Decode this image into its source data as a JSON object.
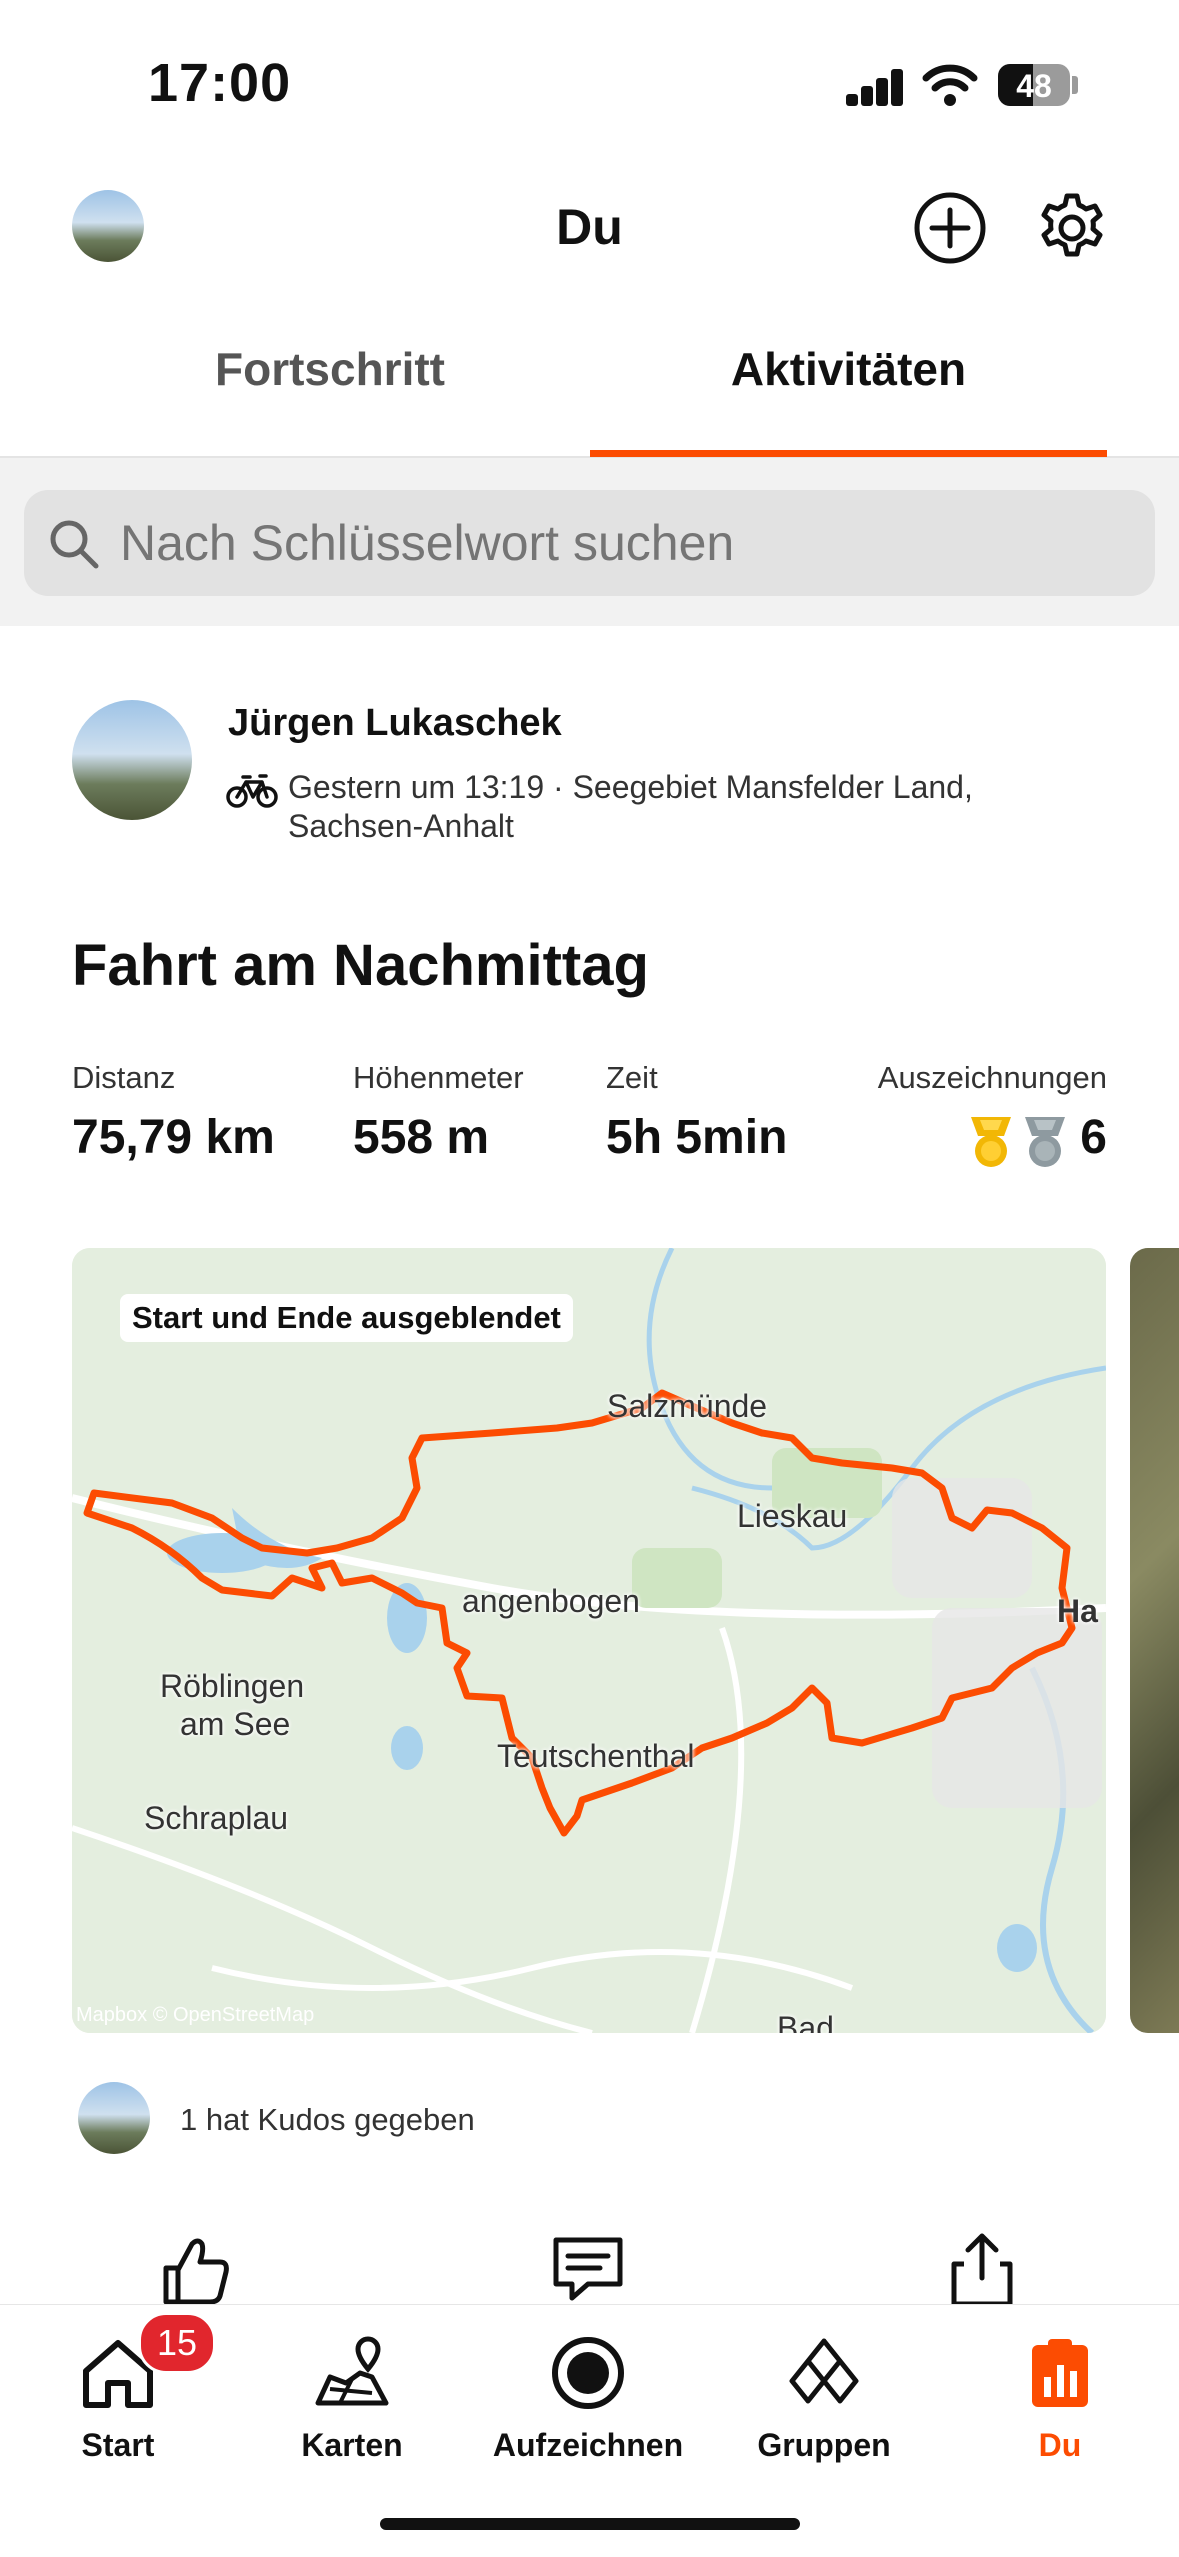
{
  "status_bar": {
    "time": "17:00",
    "battery": "48"
  },
  "header": {
    "title": "Du"
  },
  "tabs": [
    {
      "label": "Fortschritt",
      "active": false
    },
    {
      "label": "Aktivitäten",
      "active": true
    }
  ],
  "search": {
    "placeholder": "Nach Schlüsselwort suchen"
  },
  "activity": {
    "user_name": "Jürgen Lukaschek",
    "meta_line1": "Gestern um 13:19 · Seegebiet Mansfelder Land,",
    "meta_line2": "Sachsen-Anhalt",
    "title": "Fahrt am Nachmittag",
    "stats": [
      {
        "label": "Distanz",
        "value": "75,79 km"
      },
      {
        "label": "Höhenmeter",
        "value": "558 m"
      },
      {
        "label": "Zeit",
        "value": "5h 5min"
      },
      {
        "label": "Auszeichnungen",
        "value": "6"
      }
    ],
    "map": {
      "label": "Start und Ende ausgeblendet",
      "places": [
        "Salzmünde",
        "Lieskau",
        "angenbogen",
        "Röblingen",
        "am See",
        "Teutschenthal",
        "Schraplau",
        "Ha",
        "Bad"
      ],
      "attribution": "Mapbox © OpenStreetMap",
      "route_color": "#fc4c02"
    },
    "kudos": "1 hat Kudos gegeben"
  },
  "nav": [
    {
      "label": "Start",
      "icon": "home-icon",
      "badge": "15"
    },
    {
      "label": "Karten",
      "icon": "map-icon"
    },
    {
      "label": "Aufzeichnen",
      "icon": "record-icon"
    },
    {
      "label": "Gruppen",
      "icon": "groups-icon"
    },
    {
      "label": "Du",
      "icon": "you-icon",
      "active": true
    }
  ],
  "colors": {
    "accent": "#fc4c02",
    "badge": "#e1262d"
  }
}
